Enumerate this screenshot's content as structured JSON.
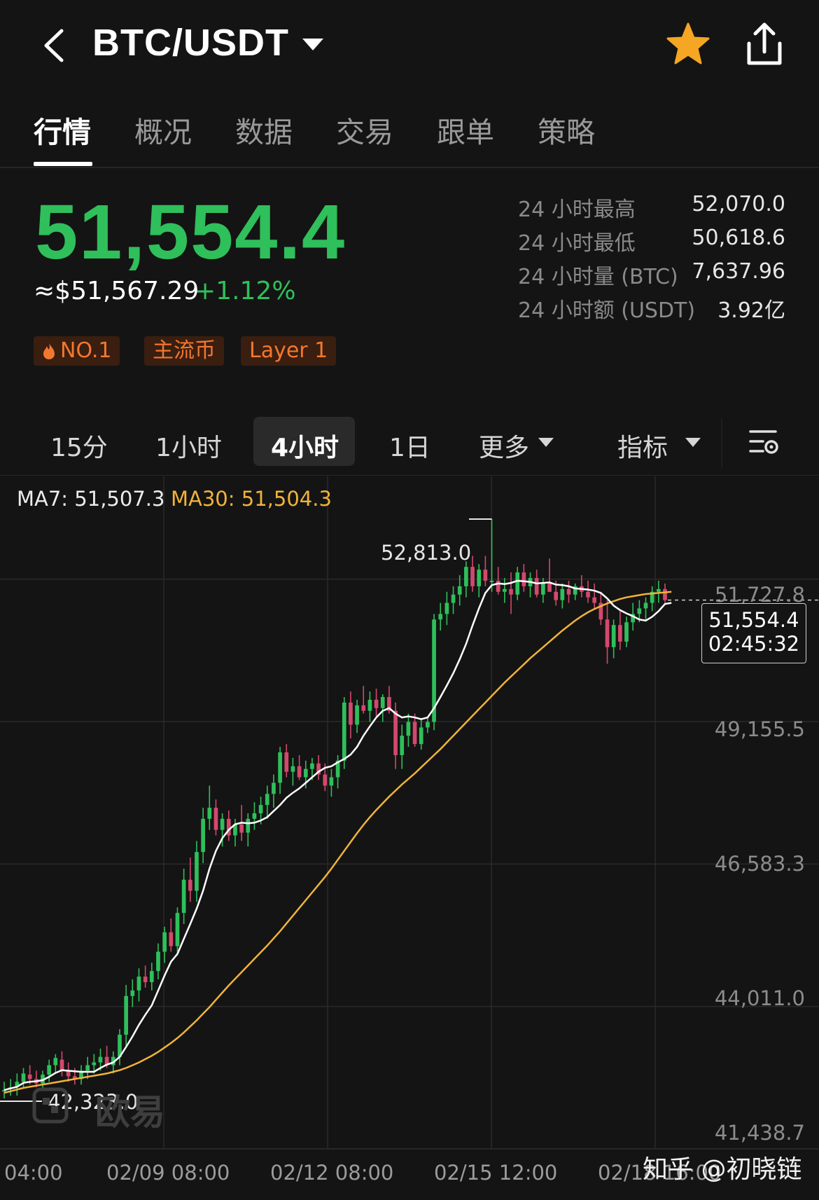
{
  "header": {
    "pair": "BTC/USDT",
    "icons": {
      "back": "chevron-left-icon",
      "dropdown": "caret-down-icon",
      "favorite": "star-icon",
      "share": "share-icon"
    },
    "favorite_color": "#f5a623"
  },
  "tabs": [
    {
      "label": "行情",
      "active": true
    },
    {
      "label": "概况",
      "active": false
    },
    {
      "label": "数据",
      "active": false
    },
    {
      "label": "交易",
      "active": false
    },
    {
      "label": "跟单",
      "active": false
    },
    {
      "label": "策略",
      "active": false
    }
  ],
  "ticker": {
    "last_price": "51,554.4",
    "usd_price": "≈$51,567.29",
    "change_pct": "+1.12%",
    "up_color": "#2fbf5b",
    "stats": [
      {
        "label": "24 小时最高",
        "value": "52,070.0"
      },
      {
        "label": "24 小时最低",
        "value": "50,618.6"
      },
      {
        "label": "24 小时量 (BTC)",
        "value": "7,637.96"
      },
      {
        "label": "24 小时额 (USDT)",
        "value": "3.92亿"
      }
    ],
    "tags": [
      {
        "label": "NO.1",
        "icon": "fire-icon"
      },
      {
        "label": "主流币"
      },
      {
        "label": "Layer 1"
      }
    ]
  },
  "timeframes": {
    "items": [
      "15分",
      "1小时",
      "4小时",
      "1日"
    ],
    "active": "4小时",
    "more_label": "更多",
    "indicators_label": "指标",
    "settings_icon": "chart-settings-icon"
  },
  "chart_data": {
    "type": "candlestick",
    "indicators": {
      "ma7_label": "MA7: 51,507.3",
      "ma30_label": "MA30: 51,504.3"
    },
    "ma_colors": {
      "ma7": "#ffffff",
      "ma30": "#f0b33a"
    },
    "candle_colors": {
      "up": "#2fbf5b",
      "down": "#d2496d"
    },
    "y_ticks": [
      "51,727.8",
      "49,155.5",
      "46,583.3",
      "44,011.0",
      "41,438.7"
    ],
    "ylim": [
      41438.7,
      53585.0
    ],
    "x_ticks": [
      "04:00",
      "02/09 08:00",
      "02/12 08:00",
      "02/15 12:00",
      "02/18 16:00"
    ],
    "high_marker": "52,813.0",
    "low_marker": "42,323.0",
    "current": {
      "price": "51,554.4",
      "countdown": "02:45:32"
    },
    "candles": [
      [
        42500,
        42650,
        42350,
        42500
      ],
      [
        42550,
        42700,
        42400,
        42550
      ],
      [
        42560,
        42800,
        42400,
        42650
      ],
      [
        42650,
        42900,
        42550,
        42800
      ],
      [
        42780,
        42950,
        42600,
        42700
      ],
      [
        42700,
        42850,
        42550,
        42620
      ],
      [
        42620,
        42850,
        42500,
        42780
      ],
      [
        42780,
        43050,
        42650,
        42950
      ],
      [
        42950,
        43150,
        42800,
        43080
      ],
      [
        43050,
        43200,
        42750,
        42850
      ],
      [
        42850,
        43000,
        42650,
        42750
      ],
      [
        42750,
        42900,
        42600,
        42700
      ],
      [
        42700,
        42950,
        42600,
        42850
      ],
      [
        42850,
        43100,
        42700,
        42950
      ],
      [
        42950,
        43150,
        42800,
        43000
      ],
      [
        43000,
        43250,
        42850,
        43100
      ],
      [
        43100,
        43300,
        42900,
        42950
      ],
      [
        42950,
        43200,
        42800,
        43100
      ],
      [
        43100,
        43600,
        42950,
        43500
      ],
      [
        43500,
        44400,
        43300,
        44200
      ],
      [
        44200,
        44500,
        44000,
        44300
      ],
      [
        44300,
        44700,
        44100,
        44550
      ],
      [
        44550,
        44750,
        44350,
        44450
      ],
      [
        44450,
        44800,
        44300,
        44650
      ],
      [
        44650,
        45150,
        44500,
        45000
      ],
      [
        45000,
        45450,
        44800,
        45350
      ],
      [
        45350,
        45600,
        45000,
        45100
      ],
      [
        45100,
        45800,
        44950,
        45700
      ],
      [
        45700,
        46500,
        45500,
        46300
      ],
      [
        46300,
        46700,
        45900,
        46100
      ],
      [
        46100,
        47000,
        45900,
        46800
      ],
      [
        46800,
        47600,
        46600,
        47400
      ],
      [
        47400,
        48000,
        47200,
        47600
      ],
      [
        47600,
        47750,
        47100,
        47200
      ],
      [
        47200,
        47500,
        46900,
        47400
      ],
      [
        47400,
        47550,
        47000,
        47100
      ],
      [
        47100,
        47400,
        46900,
        47300
      ],
      [
        47300,
        47650,
        47000,
        47150
      ],
      [
        47150,
        47500,
        46900,
        47400
      ],
      [
        47400,
        47700,
        47200,
        47500
      ],
      [
        47500,
        47800,
        47300,
        47650
      ],
      [
        47650,
        48000,
        47400,
        47850
      ],
      [
        47850,
        48200,
        47600,
        48050
      ],
      [
        48050,
        48700,
        47850,
        48600
      ],
      [
        48600,
        48750,
        48150,
        48250
      ],
      [
        48250,
        48500,
        48000,
        48350
      ],
      [
        48350,
        48550,
        48100,
        48150
      ],
      [
        48150,
        48450,
        47950,
        48300
      ],
      [
        48300,
        48500,
        48100,
        48400
      ],
      [
        48400,
        48550,
        48100,
        48200
      ],
      [
        48200,
        48400,
        47900,
        48000
      ],
      [
        48000,
        48300,
        47800,
        48150
      ],
      [
        48150,
        48550,
        47950,
        48450
      ],
      [
        48450,
        49600,
        48300,
        49500
      ],
      [
        49500,
        49700,
        48850,
        49100
      ],
      [
        49100,
        49550,
        48950,
        49450
      ],
      [
        49450,
        49800,
        49300,
        49350
      ],
      [
        49350,
        49700,
        49150,
        49550
      ],
      [
        49550,
        49750,
        49250,
        49400
      ],
      [
        49400,
        49650,
        49150,
        49600
      ],
      [
        49600,
        49800,
        49300,
        49350
      ],
      [
        49350,
        49500,
        48300,
        48550
      ],
      [
        48550,
        49100,
        48300,
        48900
      ],
      [
        48900,
        49300,
        48700,
        49150
      ],
      [
        49150,
        49300,
        48700,
        48750
      ],
      [
        48750,
        49200,
        48650,
        49050
      ],
      [
        49050,
        49250,
        48950,
        49150
      ],
      [
        49150,
        51100,
        49000,
        51000
      ],
      [
        51000,
        51300,
        50800,
        51100
      ],
      [
        51100,
        51500,
        50900,
        51300
      ],
      [
        51300,
        51600,
        51100,
        51450
      ],
      [
        51450,
        51800,
        51250,
        51600
      ],
      [
        51600,
        52050,
        51400,
        51950
      ],
      [
        51950,
        52150,
        51500,
        51600
      ],
      [
        51600,
        52000,
        51400,
        51900
      ],
      [
        51900,
        52150,
        51600,
        51700
      ],
      [
        51700,
        52813,
        51500,
        51700
      ],
      [
        51700,
        51950,
        51450,
        51500
      ],
      [
        51500,
        51750,
        51300,
        51550
      ],
      [
        51550,
        51850,
        51100,
        51450
      ],
      [
        51450,
        51950,
        51350,
        51850
      ],
      [
        51850,
        52000,
        51500,
        51600
      ],
      [
        51600,
        51850,
        51400,
        51750
      ],
      [
        51750,
        51900,
        51400,
        51450
      ],
      [
        51450,
        51750,
        51300,
        51650
      ],
      [
        51650,
        52100,
        51500,
        51500
      ],
      [
        51500,
        51700,
        51250,
        51350
      ],
      [
        51350,
        51650,
        51200,
        51550
      ],
      [
        51550,
        51700,
        51300,
        51450
      ],
      [
        51450,
        51650,
        51350,
        51600
      ],
      [
        51600,
        51800,
        51400,
        51500
      ],
      [
        51500,
        51700,
        51300,
        51400
      ],
      [
        51400,
        51650,
        51200,
        51300
      ],
      [
        51300,
        51500,
        50900,
        51000
      ],
      [
        51000,
        51350,
        50200,
        50500
      ],
      [
        50500,
        51000,
        50300,
        50900
      ],
      [
        50900,
        51150,
        50450,
        50600
      ],
      [
        50600,
        51050,
        50500,
        50950
      ],
      [
        50950,
        51300,
        50800,
        51100
      ],
      [
        51100,
        51350,
        50950,
        51200
      ],
      [
        51200,
        51400,
        51000,
        51300
      ],
      [
        51300,
        51600,
        51150,
        51500
      ],
      [
        51500,
        51700,
        51300,
        51550
      ],
      [
        51550,
        51650,
        51300,
        51350
      ]
    ],
    "ma7": [
      42500,
      42530,
      42560,
      42630,
      42650,
      42660,
      42680,
      42740,
      42810,
      42860,
      42850,
      42840,
      42830,
      42830,
      42830,
      42900,
      42960,
      43000,
      43100,
      43280,
      43470,
      43680,
      43860,
      44030,
      44300,
      44570,
      44820,
      44960,
      45230,
      45500,
      45780,
      46100,
      46500,
      46820,
      47050,
      47200,
      47300,
      47330,
      47320,
      47330,
      47370,
      47430,
      47540,
      47650,
      47780,
      47870,
      47950,
      48050,
      48150,
      48250,
      48320,
      48350,
      48420,
      48480,
      48560,
      48700,
      48900,
      49070,
      49230,
      49350,
      49400,
      49300,
      49230,
      49250,
      49230,
      49200,
      49230,
      49400,
      49600,
      49810,
      50030,
      50280,
      50560,
      50890,
      51200,
      51480,
      51620,
      51650,
      51640,
      51660,
      51700,
      51690,
      51680,
      51650,
      51660,
      51670,
      51630,
      51620,
      51600,
      51560,
      51550,
      51540,
      51520,
      51480,
      51380,
      51250,
      51170,
      51110,
      51060,
      51000,
      50980,
      51050,
      51150,
      51280,
      51300
    ],
    "ma30": [
      42450,
      42480,
      42510,
      42540,
      42560,
      42580,
      42600,
      42620,
      42640,
      42660,
      42680,
      42700,
      42720,
      42740,
      42760,
      42780,
      42800,
      42830,
      42860,
      42900,
      42950,
      43000,
      43060,
      43120,
      43190,
      43270,
      43350,
      43440,
      43540,
      43650,
      43760,
      43880,
      44000,
      44130,
      44260,
      44390,
      44510,
      44630,
      44750,
      44870,
      44990,
      45110,
      45240,
      45370,
      45510,
      45650,
      45790,
      45930,
      46070,
      46210,
      46350,
      46500,
      46660,
      46820,
      46980,
      47140,
      47290,
      47430,
      47560,
      47680,
      47800,
      47910,
      48020,
      48120,
      48220,
      48330,
      48440,
      48550,
      48660,
      48780,
      48900,
      49020,
      49140,
      49260,
      49380,
      49500,
      49620,
      49740,
      49860,
      49970,
      50080,
      50190,
      50300,
      50400,
      50500,
      50600,
      50700,
      50800,
      50890,
      50980,
      51060,
      51130,
      51190,
      51240,
      51290,
      51330,
      51370,
      51400,
      51420,
      51440,
      51460,
      51470,
      51480,
      51490,
      51500
    ]
  },
  "watermark": {
    "text": "欧易",
    "icon": "okx-logo-icon"
  },
  "credit": "知乎 @初晓链"
}
